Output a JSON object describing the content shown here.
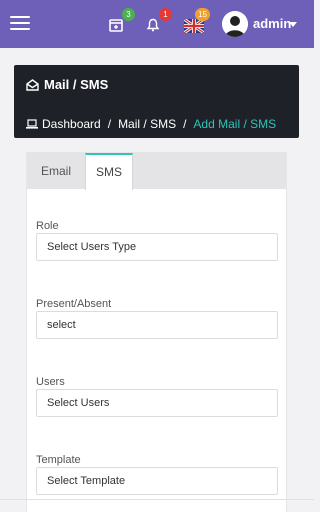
{
  "topbar": {
    "badges": {
      "calendar": "3",
      "bell": "1",
      "language": "15"
    },
    "user_name": "admin",
    "colors": {
      "bar": "#6e5fb8",
      "green": "#4caf50",
      "red": "#e53935",
      "orange": "#f0a030"
    }
  },
  "header": {
    "title": "Mail / SMS",
    "breadcrumb": {
      "home": "Dashboard",
      "parent": "Mail / SMS",
      "current": "Add Mail / SMS"
    },
    "separator": "/"
  },
  "tabs": {
    "email": "Email",
    "sms": "SMS"
  },
  "form": {
    "role": {
      "label": "Role",
      "value": "Select Users Type"
    },
    "present": {
      "label": "Present/Absent",
      "value": "select"
    },
    "users": {
      "label": "Users",
      "value": "Select Users"
    },
    "template": {
      "label": "Template",
      "value": "Select Template"
    }
  }
}
